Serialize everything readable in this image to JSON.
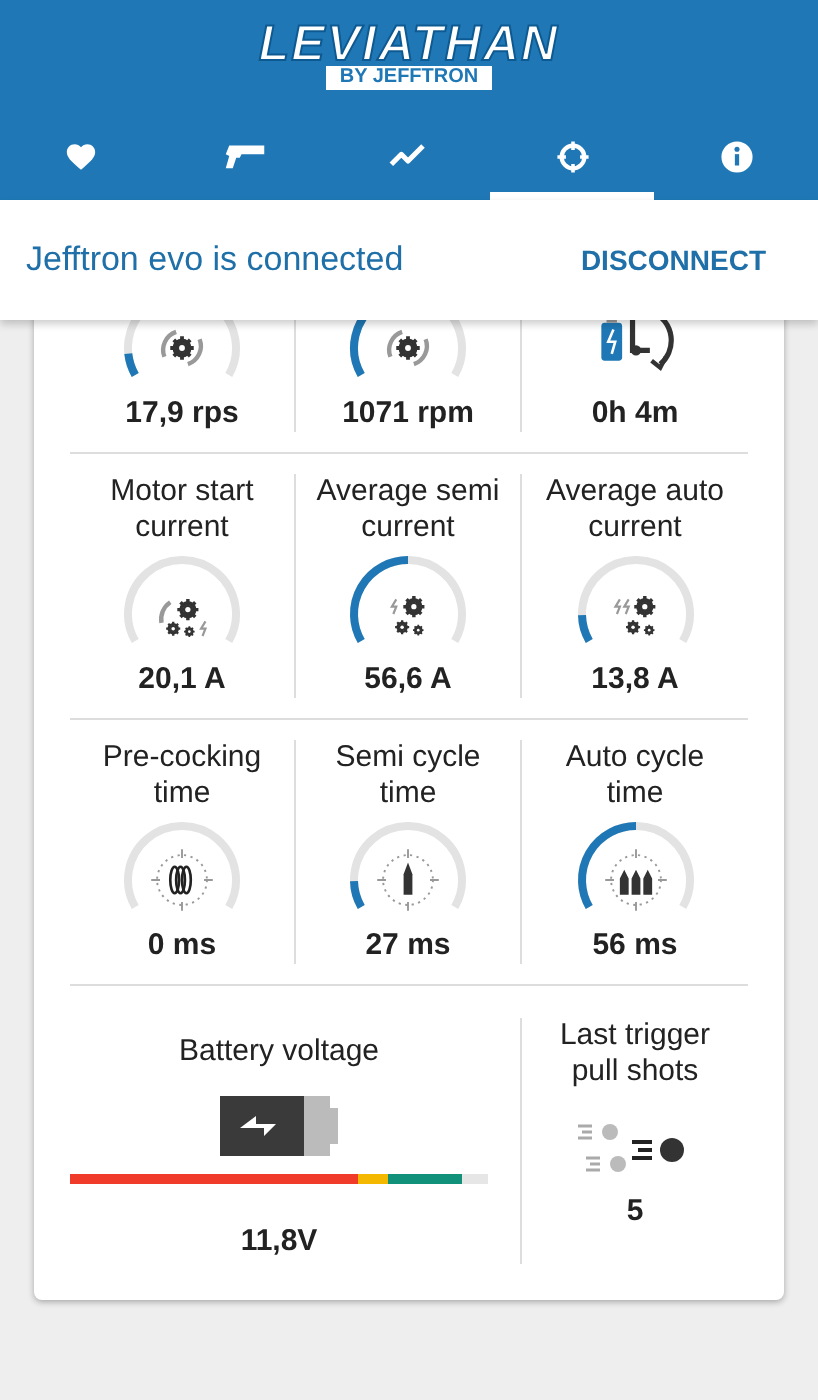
{
  "header": {
    "logo_title": "LEVIATHAN",
    "logo_subtitle": "BY JEFFTRON"
  },
  "tabs": [
    {
      "selected": false
    },
    {
      "selected": false
    },
    {
      "selected": false
    },
    {
      "selected": true
    },
    {
      "selected": false
    }
  ],
  "connection": {
    "message": "Jefftron evo is connected",
    "action": "DISCONNECT"
  },
  "rows": [
    {
      "tiles": [
        {
          "kind": "gauge",
          "value": "17,9 rps"
        },
        {
          "kind": "gauge",
          "value": "1071 rpm"
        },
        {
          "kind": "icon",
          "value": "0h 4m"
        }
      ]
    },
    {
      "tiles": [
        {
          "kind": "gauge",
          "label": "Motor start current",
          "value": "20,1 A"
        },
        {
          "kind": "gauge",
          "label": "Average semi current",
          "value": "56,6 A"
        },
        {
          "kind": "gauge",
          "label": "Average auto current",
          "value": "13,8 A"
        }
      ]
    },
    {
      "tiles": [
        {
          "kind": "gauge",
          "label": "Pre-cocking time",
          "value": "0 ms"
        },
        {
          "kind": "gauge",
          "label": "Semi cycle time",
          "value": "27 ms"
        },
        {
          "kind": "gauge",
          "label": "Auto cycle time",
          "value": "56 ms"
        }
      ]
    }
  ],
  "battery": {
    "label": "Battery voltage",
    "value": "11,8V"
  },
  "last_shots": {
    "label": "Last trigger pull shots",
    "value": "5"
  }
}
